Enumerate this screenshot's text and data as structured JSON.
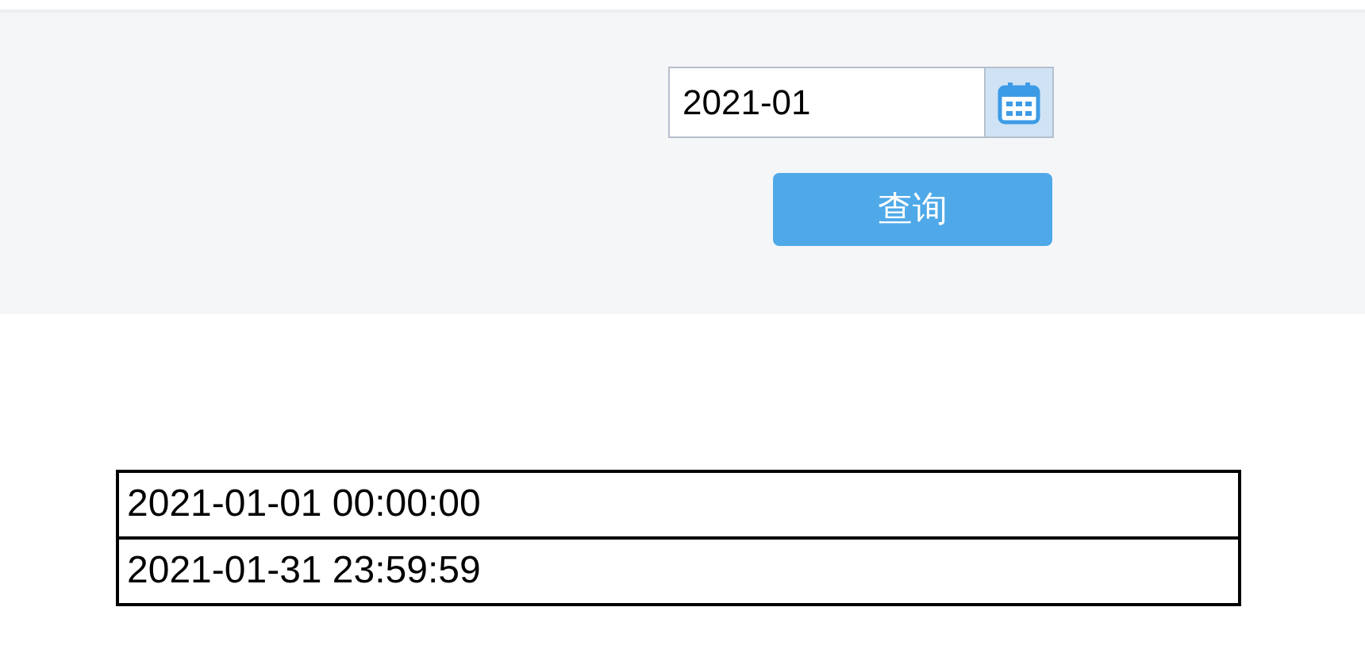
{
  "filter": {
    "month_value": "2021-01",
    "query_button": "查询"
  },
  "table": {
    "rows": [
      {
        "cells": [
          "2021-01-01 00:00:00"
        ]
      },
      {
        "cells": [
          "2021-01-31 23:59:59"
        ]
      }
    ]
  }
}
